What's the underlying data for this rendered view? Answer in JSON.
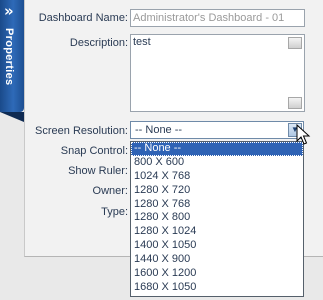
{
  "side_tab": {
    "label": "Properties",
    "collapse_glyph": "»"
  },
  "form": {
    "dashboard_name": {
      "label": "Dashboard Name:",
      "value": "Administrator's Dashboard - 01"
    },
    "description": {
      "label": "Description:",
      "value": "test"
    },
    "screen_resolution": {
      "label": "Screen Resolution:",
      "value": "-- None --"
    },
    "snap_control": {
      "label": "Snap Control:"
    },
    "show_ruler": {
      "label": "Show Ruler:"
    },
    "owner": {
      "label": "Owner:"
    },
    "type": {
      "label": "Type:"
    }
  },
  "resolution_options": [
    "-- None --",
    "800 X 600",
    "1024 X 768",
    "1280 X 720",
    "1280 X 768",
    "1280 X 800",
    "1280 X 1024",
    "1400 X 1050",
    "1440 X 900",
    "1600 X 1200",
    "1680 X 1050"
  ],
  "selected_option_index": 0,
  "colors": {
    "tab_blue": "#2e6ab8",
    "selection": "#2f63b5"
  }
}
